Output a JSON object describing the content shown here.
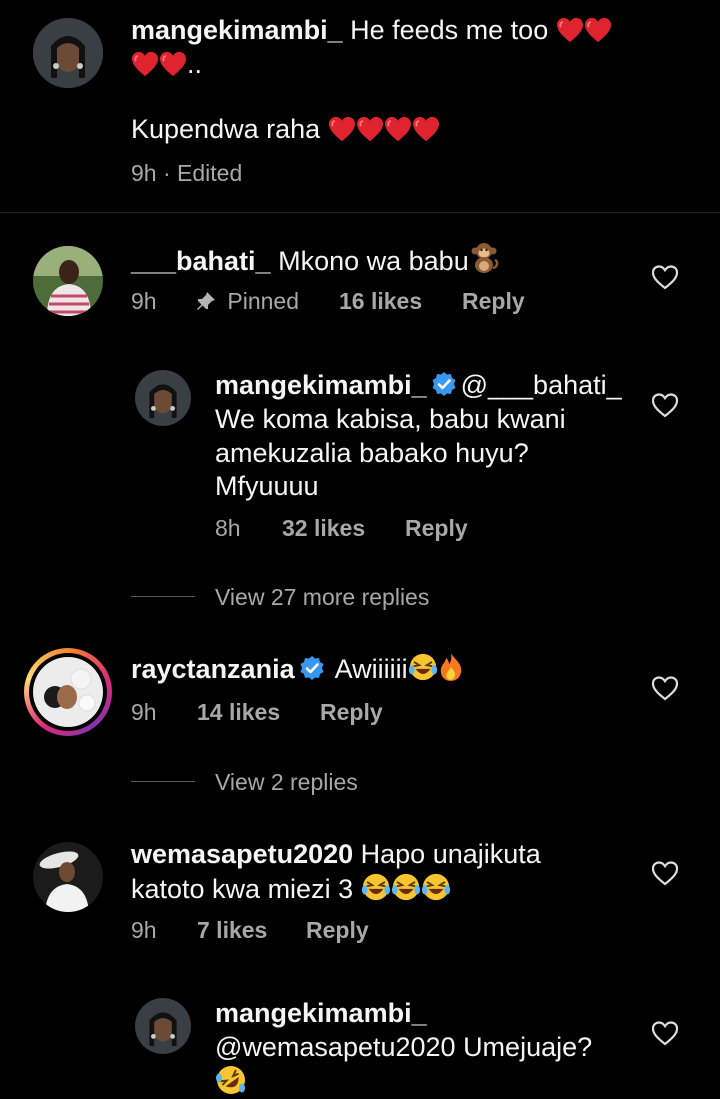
{
  "comments": [
    {
      "username": "mangekimambi_",
      "text_line1": "He feeds me too",
      "text_line3": "Kupendwa raha",
      "trailing": "..",
      "time": "9h",
      "edited": "· Edited"
    },
    {
      "username": "___bahati_",
      "text": "Mkono wa babu",
      "time": "9h",
      "pinned": "Pinned",
      "likes": "16 likes",
      "reply": "Reply",
      "view_more": "View 27 more replies"
    },
    {
      "username": "mangekimambi_",
      "mention": "@___bahati_",
      "line2": "We koma kabisa, babu kwani",
      "line3": "amekuzalia babako huyu?",
      "line4": "Mfyuuuu",
      "time": "8h",
      "likes": "32 likes",
      "reply": "Reply"
    },
    {
      "username": "rayctanzania",
      "text": "Awiiiiii",
      "time": "9h",
      "likes": "14 likes",
      "reply": "Reply",
      "view_more": "View 2 replies"
    },
    {
      "username": "wemasapetu2020",
      "text_line1": "Hapo unajikuta",
      "text_line2": "katoto kwa miezi 3",
      "time": "9h",
      "likes": "7 likes",
      "reply": "Reply"
    },
    {
      "username": "mangekimambi_",
      "line2": "@wemasapetu2020 Umejuaje?"
    }
  ],
  "colors": {
    "background": "#000000",
    "text": "#f5f5f5",
    "meta": "#a8a8a8",
    "verified": "#3897f0",
    "heart_emoji": "#e0242f"
  },
  "icons": [
    "heart-outline-icon",
    "pin-icon",
    "verified-badge-icon",
    "red-heart-emoji",
    "monkey-emoji",
    "laughing-emoji",
    "fire-emoji",
    "rolling-laugh-emoji"
  ]
}
